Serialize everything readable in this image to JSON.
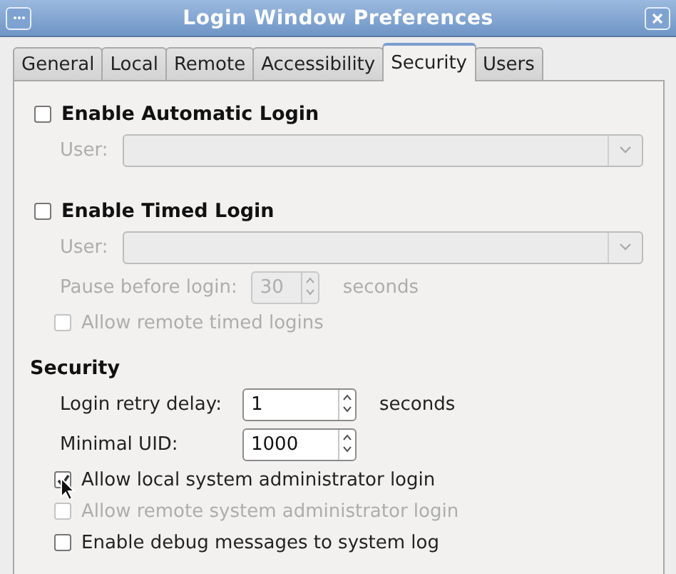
{
  "window": {
    "title": "Login Window Preferences"
  },
  "tabs": [
    {
      "label": "General",
      "selected": false
    },
    {
      "label": "Local",
      "selected": false
    },
    {
      "label": "Remote",
      "selected": false
    },
    {
      "label": "Accessibility",
      "selected": false
    },
    {
      "label": "Security",
      "selected": true
    },
    {
      "label": "Users",
      "selected": false
    }
  ],
  "automatic_login": {
    "label": "Enable Automatic Login",
    "checked": false,
    "user": {
      "label": "User:",
      "disabled": true
    }
  },
  "timed_login": {
    "label": "Enable Timed Login",
    "checked": false,
    "user": {
      "label": "User:",
      "disabled": true
    },
    "pause": {
      "label": "Pause before login:",
      "value": "30",
      "unit": "seconds",
      "disabled": true
    },
    "allow_remote": {
      "label": "Allow remote timed logins",
      "checked": false,
      "disabled": true
    }
  },
  "security": {
    "heading": "Security",
    "spinners": [
      {
        "label": "Login retry delay:",
        "value": "1",
        "unit": "seconds",
        "disabled": false
      },
      {
        "label": "Minimal UID:",
        "value": "1000",
        "disabled": false
      }
    ],
    "options": [
      {
        "label": "Allow local system administrator login",
        "checked": true,
        "disabled": false
      },
      {
        "label": "Allow remote system administrator login",
        "checked": false,
        "disabled": true
      },
      {
        "label": "Enable debug messages to system log",
        "checked": false,
        "disabled": false
      }
    ]
  }
}
